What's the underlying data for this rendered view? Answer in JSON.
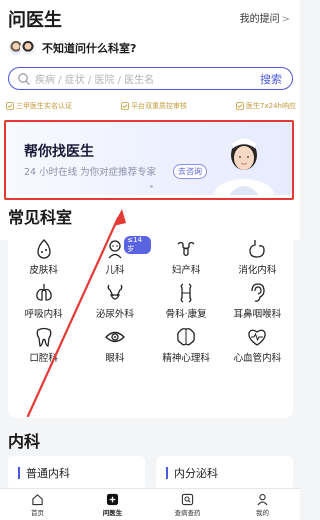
{
  "header": {
    "title": "问医生",
    "my_questions": "我的提问",
    "my_questions_chevron": ">"
  },
  "doctor_prompt": "不知道问什么科室?",
  "search": {
    "placeholder": "疾病 / 症状 / 医院 / 医生名",
    "button": "搜索"
  },
  "trust_items": [
    {
      "label": "三甲医生实名认证"
    },
    {
      "label": "平台双重质控审核"
    },
    {
      "label": "医生7x24h响应"
    }
  ],
  "banner": {
    "title": "帮你找医生",
    "subtitle": "24 小时在线 为你对症推荐专家",
    "cta": "去咨询"
  },
  "departments_section": {
    "title": "常见科室",
    "items": [
      {
        "label": "皮肤科",
        "icon": "skin-icon"
      },
      {
        "label": "儿科",
        "icon": "child-icon",
        "badge": "≤14岁"
      },
      {
        "label": "妇产科",
        "icon": "uterus-icon"
      },
      {
        "label": "消化内科",
        "icon": "stomach-icon"
      },
      {
        "label": "呼吸内科",
        "icon": "lungs-icon"
      },
      {
        "label": "泌尿外科",
        "icon": "urinary-icon"
      },
      {
        "label": "骨科·康复",
        "icon": "bone-icon"
      },
      {
        "label": "耳鼻咽喉科",
        "icon": "ear-icon"
      },
      {
        "label": "口腔科",
        "icon": "tooth-icon"
      },
      {
        "label": "眼科",
        "icon": "eye-icon"
      },
      {
        "label": "精神心理科",
        "icon": "brain-icon"
      },
      {
        "label": "心血管内科",
        "icon": "heart-icon"
      }
    ]
  },
  "internal_section": {
    "title": "内科",
    "cards": [
      {
        "label": "普通内科"
      },
      {
        "label": "内分泌科"
      }
    ]
  },
  "tabbar": [
    {
      "label": "首页",
      "icon": "home-icon"
    },
    {
      "label": "问医生",
      "icon": "ask-doctor-icon",
      "active": true
    },
    {
      "label": "查病查药",
      "icon": "search-drug-icon"
    },
    {
      "label": "我的",
      "icon": "profile-icon"
    }
  ],
  "colors": {
    "accent": "#4b58e0",
    "trust_gold": "#c49a3a",
    "annotation_red": "#e53935"
  }
}
